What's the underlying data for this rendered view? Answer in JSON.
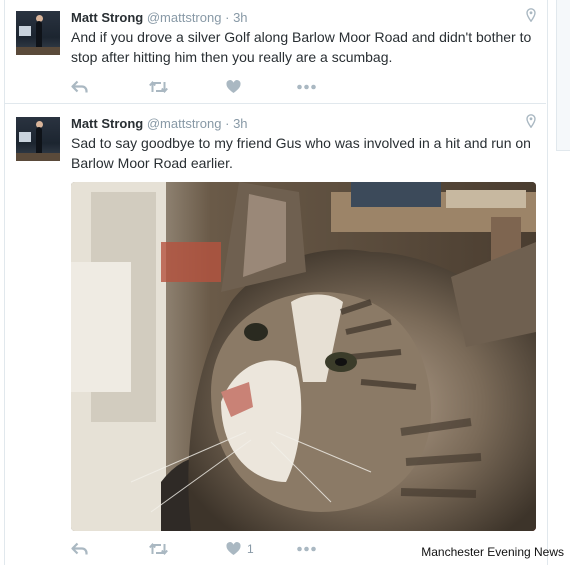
{
  "tweets": [
    {
      "author_name": "Matt Strong",
      "handle": "@mattstrong",
      "separator": "·",
      "time": "3h",
      "text": "And if you drove a silver Golf along Barlow Moor Road and didn't bother to stop after hitting him then you really are a scumbag.",
      "like_count": ""
    },
    {
      "author_name": "Matt Strong",
      "handle": "@mattstrong",
      "separator": "·",
      "time": "3h",
      "text": "Sad to say goodbye to my friend Gus who was involved in a hit and run on Barlow Moor Road earlier.",
      "like_count": "1"
    }
  ],
  "icons": {
    "location": "location-pin-icon",
    "reply": "reply-icon",
    "retweet": "retweet-icon",
    "like": "heart-icon",
    "more": "more-dots-icon"
  },
  "colors": {
    "name": "#292f33",
    "muted": "#8899a6",
    "action": "#aab8c2",
    "divider": "#e1e8ed"
  },
  "credit": "Manchester Evening News"
}
